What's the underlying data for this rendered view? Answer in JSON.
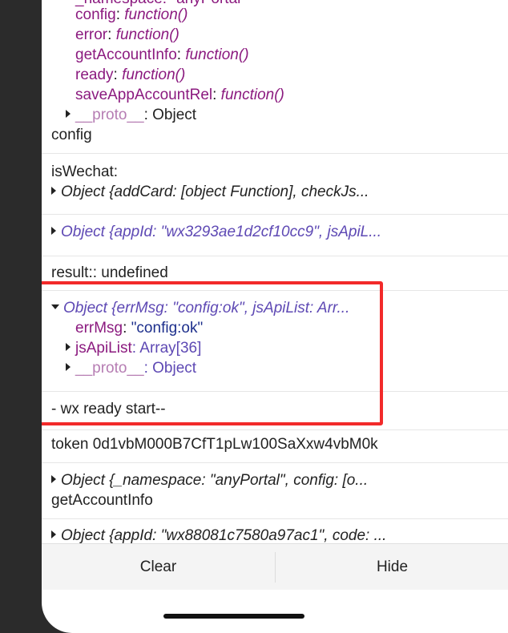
{
  "log": {
    "entry1": {
      "partial_top": "_namespace: \"anyPortal\"",
      "props": [
        {
          "key": "config",
          "value": "function()"
        },
        {
          "key": "error",
          "value": "function()"
        },
        {
          "key": "getAccountInfo",
          "value": "function()"
        },
        {
          "key": "ready",
          "value": "function()"
        },
        {
          "key": "saveAppAccountRel",
          "value": "function()"
        }
      ],
      "proto_key": "__proto__",
      "proto_value": "Object",
      "label": "config"
    },
    "entry2": {
      "label": "isWechat:",
      "object": "Object {addCard: [object Function], checkJs..."
    },
    "entry3": {
      "object": "Object {appId: \"wx3293ae1d2cf10cc9\", jsApiL..."
    },
    "entry4": {
      "text": "result:: undefined"
    },
    "entry5": {
      "object": "Object {errMsg: \"config:ok\", jsApiList: Arr...",
      "errmsg_key": "errMsg",
      "errmsg_value": "\"config:ok\"",
      "jsapi_key": "jsApiList",
      "jsapi_value": "Array[36]",
      "proto_key": "__proto__",
      "proto_value": "Object"
    },
    "entry6": {
      "text": "- wx ready start--"
    },
    "entry7": {
      "text": "token 0d1vbM000B7CfT1pLw100SaXxw4vbM0k"
    },
    "entry8": {
      "object": "Object {_namespace: \"anyPortal\", config: [o...",
      "label": "getAccountInfo"
    },
    "entry9": {
      "object": "Object {appId: \"wx88081c7580a97ac1\", code: ..."
    }
  },
  "toolbar": {
    "clear_label": "Clear",
    "hide_label": "Hide"
  },
  "colors": {
    "highlight": "#f22a2a",
    "key": "#8b1a7f",
    "string": "#1d2f8c",
    "object_blue": "#5e49b4"
  }
}
